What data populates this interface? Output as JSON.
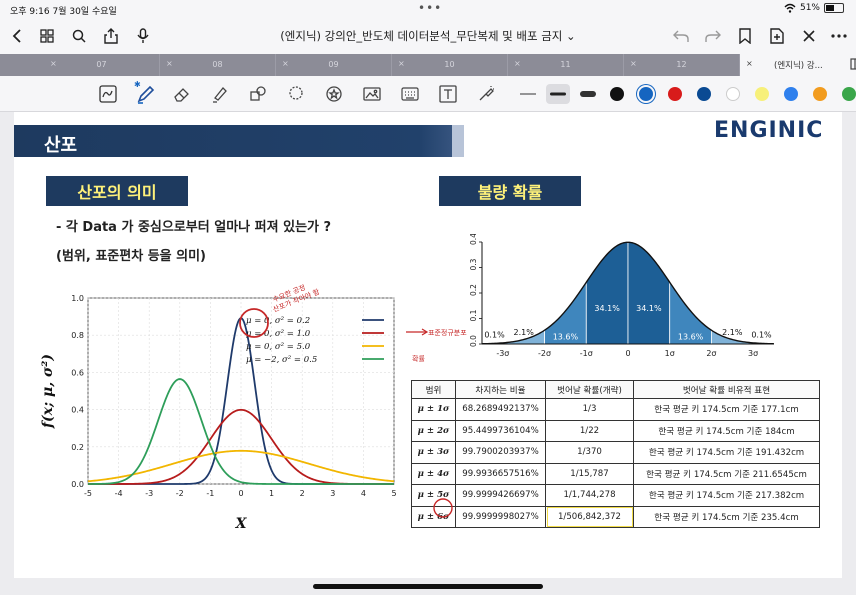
{
  "status_bar": {
    "time": "오후 9:16   7월 30일 수요일",
    "battery": "51%",
    "battery_level": 0.51
  },
  "nav": {
    "title": "(엔지닉) 강의안_반도체 데이터분석_무단복제 및 배포 금지 ⌄"
  },
  "tabs": [
    {
      "label": "07"
    },
    {
      "label": "08"
    },
    {
      "label": "09"
    },
    {
      "label": "10"
    },
    {
      "label": "11"
    },
    {
      "label": "12"
    },
    {
      "label": "(엔지닉) 강..."
    }
  ],
  "tab_close": "×",
  "toolbar": {
    "bluetooth": "✱",
    "colors": [
      "#111111",
      "#1565c0",
      "#d81b1b",
      "#0a4a93",
      "#ffffff",
      "#f7f07a",
      "#2f80ed",
      "#f29c1f",
      "#3aa64a"
    ]
  },
  "slide": {
    "banner_title": "산포",
    "logo": "ENGINIC",
    "section_left": "산포의 의미",
    "section_right": "불량 확률",
    "line1": "- 각 Data 가 중심으로부터 얼마나 퍼져 있는가 ?",
    "line2": "(범위, 표준편차 등을 의미)",
    "annotation_peak": "수요한 공정\n산포가 작아야 함",
    "annotation_arrow": "표준정규분포",
    "annotation_table": "확률"
  },
  "chart_data": [
    {
      "type": "line",
      "title": "",
      "xlabel": "X",
      "ylabel": "f(x; μ, σ²)",
      "xlim": [
        -5,
        5
      ],
      "ylim": [
        0,
        1.0
      ],
      "x_ticks": [
        "-5",
        "-4",
        "-3",
        "-2",
        "-1",
        "0",
        "1",
        "2",
        "3",
        "4",
        "5"
      ],
      "y_ticks": [
        "0.0",
        "0.2",
        "0.4",
        "0.6",
        "0.8",
        "1.0"
      ],
      "grid": true,
      "legend_position": "top-right",
      "series": [
        {
          "name": "μ = 0,   σ² = 0.2",
          "mu": 0,
          "var": 0.2,
          "color": "#1f3a6b"
        },
        {
          "name": "μ = 0,   σ² = 1.0",
          "mu": 0,
          "var": 1.0,
          "color": "#b71c1c"
        },
        {
          "name": "μ = 0,   σ² = 5.0",
          "mu": 0,
          "var": 5.0,
          "color": "#f2b600"
        },
        {
          "name": "μ = −2,  σ² = 0.5",
          "mu": -2,
          "var": 0.5,
          "color": "#2e9e5a"
        }
      ]
    },
    {
      "type": "area",
      "title": "",
      "xlim": [
        -3.5,
        3.5
      ],
      "ylim": [
        0,
        0.4
      ],
      "y_ticks": [
        "0.0",
        "0.1",
        "0.2",
        "0.3",
        "0.4"
      ],
      "x_ticks": [
        "-3σ",
        "-2σ",
        "-1σ",
        "0",
        "1σ",
        "2σ",
        "3σ"
      ],
      "regions": [
        {
          "from": -3,
          "to": -2,
          "label": "2.1%"
        },
        {
          "from": -2,
          "to": -1,
          "label": "13.6%"
        },
        {
          "from": -1,
          "to": 0,
          "label": "34.1%"
        },
        {
          "from": 0,
          "to": 1,
          "label": "34.1%"
        },
        {
          "from": 1,
          "to": 2,
          "label": "13.6%"
        },
        {
          "from": 2,
          "to": 3,
          "label": "2.1%"
        }
      ],
      "tails": [
        {
          "side": "left",
          "label": "0.1%"
        },
        {
          "side": "right",
          "label": "0.1%"
        }
      ]
    },
    {
      "type": "table",
      "headers": [
        "범위",
        "차지하는 비율",
        "벗어날 확률(개략)",
        "벗어날 확률 비유적 표현"
      ],
      "rows": [
        [
          "μ ± 1σ",
          "68.2689492137%",
          "1/3",
          "한국 평균 키 174.5cm 기준 177.1cm"
        ],
        [
          "μ ± 2σ",
          "95.4499736104%",
          "1/22",
          "한국 평균 키 174.5cm 기준 184cm"
        ],
        [
          "μ ± 3σ",
          "99.7900203937%",
          "1/370",
          "한국 평균 키 174.5cm 기준 191.432cm"
        ],
        [
          "μ ± 4σ",
          "99.9936657516%",
          "1/15,787",
          "한국 평균 키 174.5cm 기준 211.6545cm"
        ],
        [
          "μ ± 5σ",
          "99.9999426697%",
          "1/1,744,278",
          "한국 평균 키 174.5cm 기준 217.382cm"
        ],
        [
          "μ ± 6σ",
          "99.9999998027%",
          "1/506,842,372",
          "한국 평균 키 174.5cm 기준 235.4cm"
        ]
      ]
    }
  ]
}
